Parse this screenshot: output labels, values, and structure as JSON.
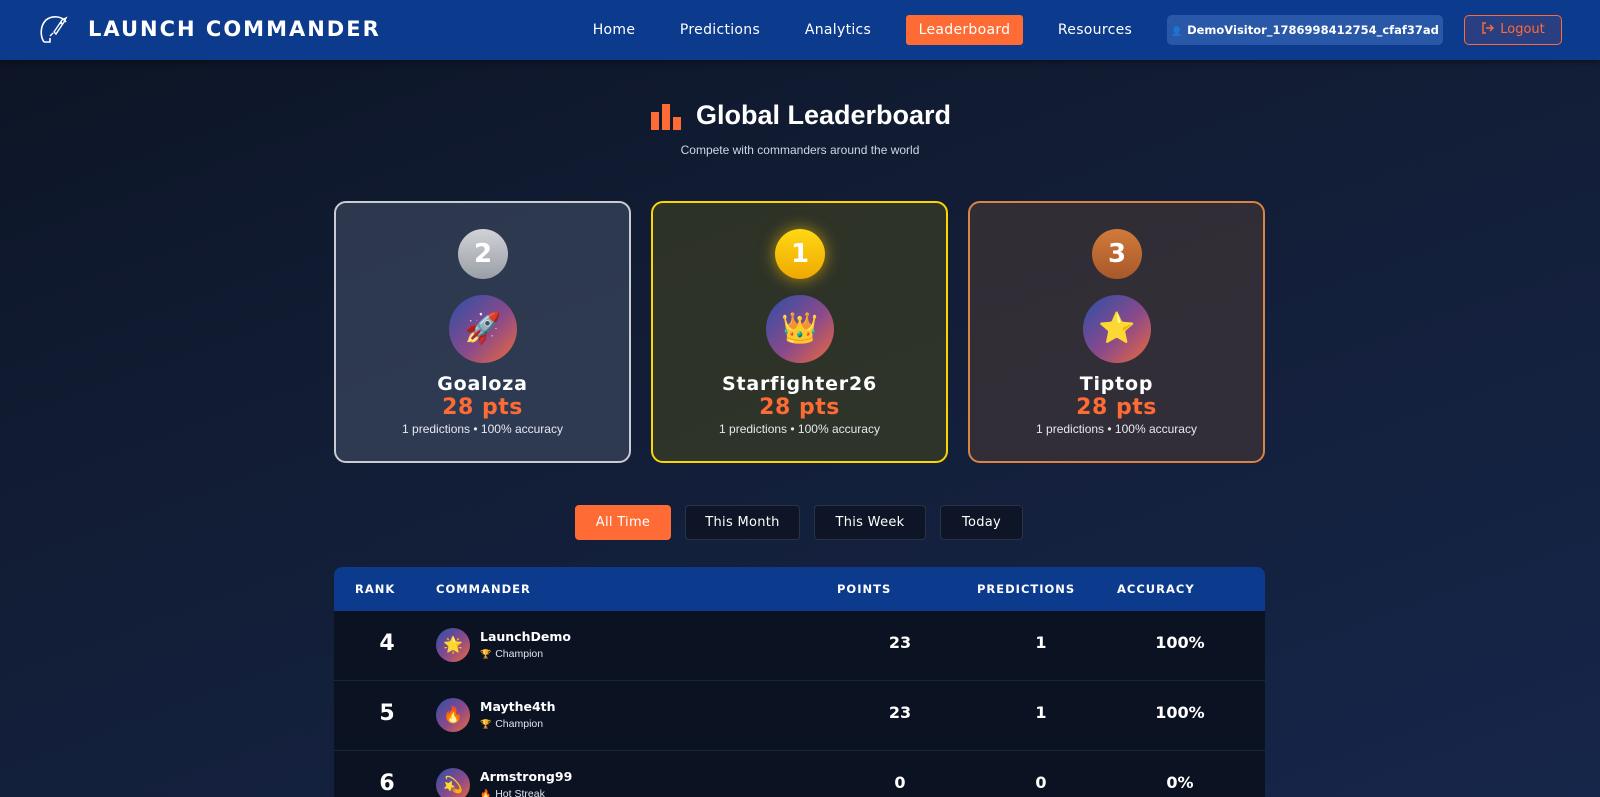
{
  "brand": "LAUNCH COMMANDER",
  "nav": {
    "links": [
      "Home",
      "Predictions",
      "Analytics",
      "Leaderboard",
      "Resources"
    ],
    "active": "Leaderboard",
    "user": "DemoVisitor_1786998412754_cfaf37ad",
    "logout": "Logout"
  },
  "header": {
    "title": "Global Leaderboard",
    "subtitle": "Compete with commanders around the world"
  },
  "podium": [
    {
      "rank": "2",
      "avatar": "🚀",
      "name": "Goaloza",
      "points": "28 pts",
      "stats": "1 predictions • 100% accuracy"
    },
    {
      "rank": "1",
      "avatar": "👑",
      "name": "Starfighter26",
      "points": "28 pts",
      "stats": "1 predictions • 100% accuracy"
    },
    {
      "rank": "3",
      "avatar": "⭐",
      "name": "Tiptop",
      "points": "28 pts",
      "stats": "1 predictions • 100% accuracy"
    }
  ],
  "filters": [
    "All Time",
    "This Month",
    "This Week",
    "Today"
  ],
  "table": {
    "headers": [
      "RANK",
      "COMMANDER",
      "POINTS",
      "PREDICTIONS",
      "ACCURACY"
    ],
    "rows": [
      {
        "rank": "4",
        "avatar": "🌟",
        "name": "LaunchDemo",
        "title_icon": "🏆",
        "title": "Champion",
        "points": "23",
        "predictions": "1",
        "accuracy": "100%"
      },
      {
        "rank": "5",
        "avatar": "🔥",
        "name": "Maythe4th",
        "title_icon": "🏆",
        "title": "Champion",
        "points": "23",
        "predictions": "1",
        "accuracy": "100%"
      },
      {
        "rank": "6",
        "avatar": "💫",
        "name": "Armstrong99",
        "title_icon": "🔥",
        "title": "Hot Streak",
        "points": "0",
        "predictions": "0",
        "accuracy": "0%"
      }
    ]
  },
  "colors": {
    "accent": "#ff6b35",
    "nav": "#0c3a8c",
    "gold": "#ffd400",
    "silver": "#c9ccd3",
    "bronze": "#d98442"
  }
}
